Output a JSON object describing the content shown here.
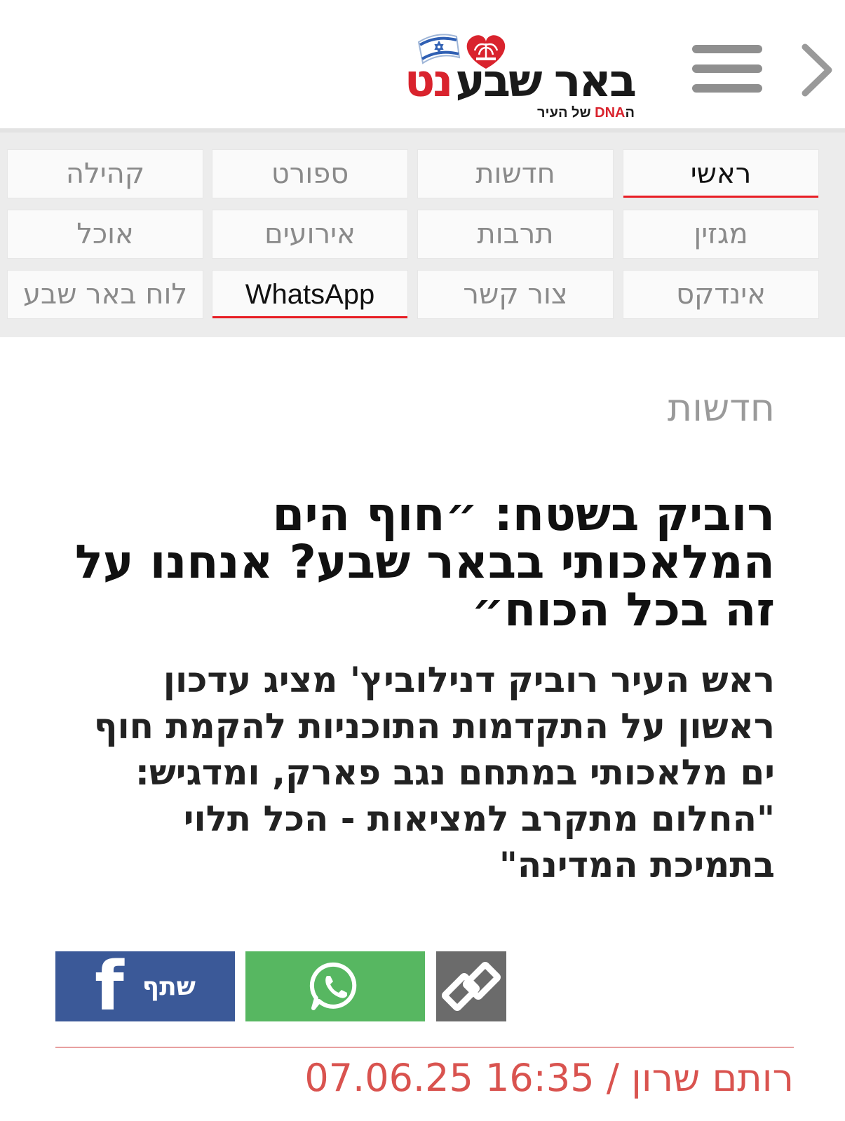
{
  "header": {
    "logo": {
      "name_main": "באר שבע",
      "name_accent": "נט",
      "tagline_prefix": "ה",
      "tagline_dna": "DNA",
      "tagline_suffix": "של העיר"
    },
    "back_icon": "chevron-right-icon",
    "menu_icon": "hamburger-menu-icon"
  },
  "nav": {
    "items": [
      {
        "label": "ראשי",
        "active": true
      },
      {
        "label": "חדשות",
        "active": false
      },
      {
        "label": "ספורט",
        "active": false
      },
      {
        "label": "קהילה",
        "active": false
      },
      {
        "label": "מגזין",
        "active": false
      },
      {
        "label": "תרבות",
        "active": false
      },
      {
        "label": "אירועים",
        "active": false
      },
      {
        "label": "אוכל",
        "active": false
      },
      {
        "label": "אינדקס",
        "active": false
      },
      {
        "label": "צור קשר",
        "active": false
      },
      {
        "label": "WhatsApp",
        "active": true
      },
      {
        "label": "לוח באר שבע",
        "active": false
      }
    ]
  },
  "article": {
    "category": "חדשות",
    "headline": "רוביק בשטח: ״חוף הים המלאכותי בבאר שבע? אנחנו על זה בכל הכוח״",
    "subheadline": "ראש העיר רוביק דנילוביץ' מציג עדכון ראשון על התקדמות התוכניות להקמת חוף ים מלאכותי במתחם נגב פארק, ומדגיש: \"החלום מתקרב למציאות - הכל תלוי בתמיכת המדינה\"",
    "author": "רותם שרון",
    "separator": "/",
    "timestamp": "07.06.25 16:35"
  },
  "share": {
    "facebook_label": "שתף",
    "facebook_icon": "facebook-f-icon",
    "whatsapp_icon": "whatsapp-icon",
    "link_icon": "chain-link-icon"
  },
  "colors": {
    "accent_red": "#e81e25",
    "facebook_blue": "#3b5998",
    "whatsapp_green": "#57b761",
    "link_gray": "#6b6b6b",
    "byline_red": "#d9534f"
  }
}
